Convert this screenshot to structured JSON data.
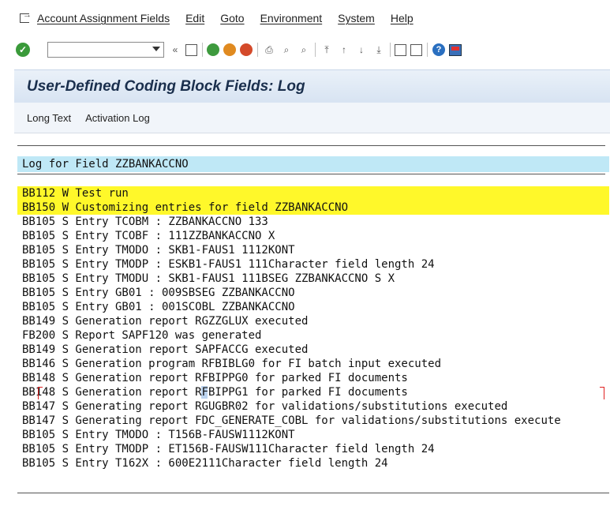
{
  "menubar": {
    "items": [
      "Account Assignment Fields",
      "Edit",
      "Goto",
      "Environment",
      "System",
      "Help"
    ]
  },
  "toolbar": {
    "command_field_value": "",
    "icons": [
      "enter-icon",
      "back-icon",
      "exit-icon",
      "cancel-icon",
      "print-icon",
      "find-icon",
      "find-next-icon",
      "first-page-icon",
      "previous-page-icon",
      "next-page-icon",
      "last-page-icon",
      "new-session-icon",
      "shortcut-icon",
      "help-icon",
      "layout-icon"
    ]
  },
  "page": {
    "title": "User-Defined Coding Block Fields: Log"
  },
  "apptoolbar": {
    "long_text": "Long Text",
    "activation_log": "Activation Log"
  },
  "log": {
    "header": "Log for Field ZZBANKACCNO",
    "rows": [
      {
        "text": "BB112 W Test run",
        "highlight": true
      },
      {
        "text": "BB150 W Customizing entries for field ZZBANKACCNO",
        "highlight": true
      },
      {
        "text": "BB105 S Entry TCOBM : ZZBANKACCNO 133"
      },
      {
        "text": "BB105 S Entry TCOBF : 111ZZBANKACCNO X"
      },
      {
        "text": "BB105 S Entry TMODO : SKB1-FAUS1 1112KONT"
      },
      {
        "text": "BB105 S Entry TMODP : ESKB1-FAUS1 111Character field length 24"
      },
      {
        "text": "BB105 S Entry TMODU : SKB1-FAUS1 111BSEG ZZBANKACCNO S X"
      },
      {
        "text": "BB105 S Entry GB01 : 009SBSEG ZZBANKACCNO"
      },
      {
        "text": "BB105 S Entry GB01 : 001SCOBL ZZBANKACCNO"
      },
      {
        "text": "BB149 S Generation report RGZZGLUX executed"
      },
      {
        "text": "FB200 S Report SAPF120 was generated"
      },
      {
        "text": "BB149 S Generation report SAPFACCG executed"
      },
      {
        "text": "BB146 S Generation program RFBIBLG0 for FI batch input executed"
      },
      {
        "text": "BB148 S Generation report RFBIPPG0 for parked FI documents"
      },
      {
        "text": "BB148 S Generation report RFBIPPG1 for parked FI documents",
        "selected": true
      },
      {
        "text": "BB147 S Generating report RGUGBR02 for validations/substitutions executed"
      },
      {
        "text": "BB147 S Generating report FDC_GENERATE_COBL for validations/substitutions execute"
      },
      {
        "text": "BB105 S Entry TMODO : T156B-FAUSW1112KONT"
      },
      {
        "text": "BB105 S Entry TMODP : ET156B-FAUSW111Character field length 24"
      },
      {
        "text": "BB105 S Entry T162X : 600E2111Character field length 24"
      }
    ]
  }
}
